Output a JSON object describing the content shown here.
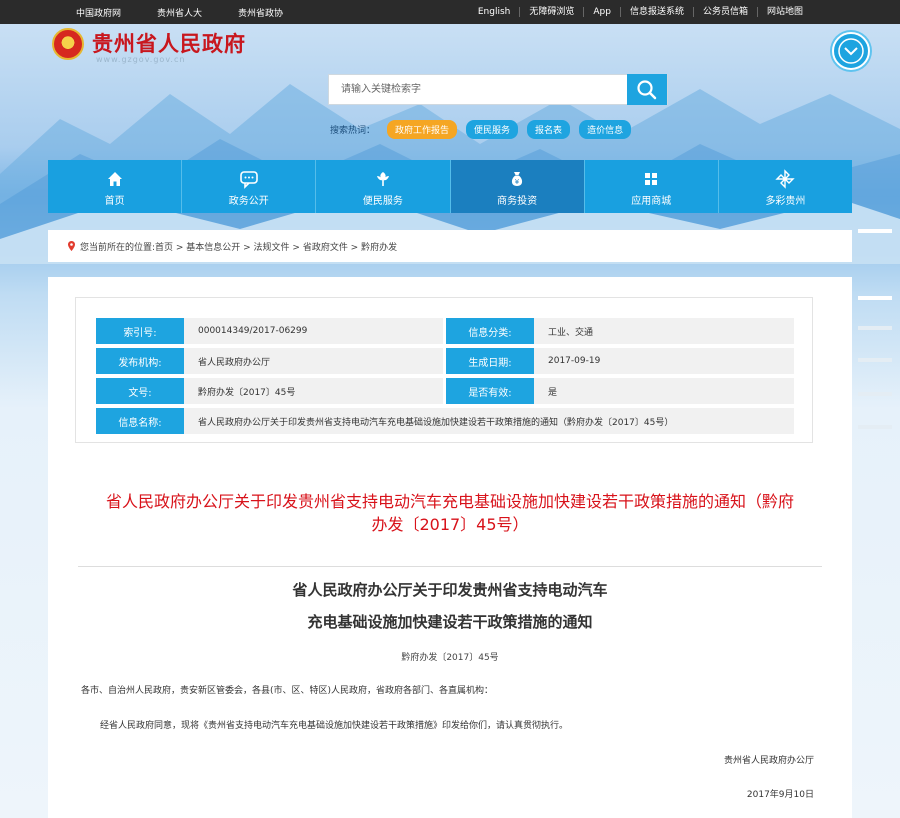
{
  "topbar": {
    "left": [
      "中国政府网",
      "贵州省人大",
      "贵州省政协"
    ],
    "right": [
      "English",
      "无障碍浏览",
      "App",
      "信息报送系统",
      "公务员信箱",
      "网站地图"
    ]
  },
  "header": {
    "site_name": "贵州省人民政府",
    "site_url": "www.gzgov.gov.cn"
  },
  "search": {
    "placeholder": "请输入关键检索字",
    "hot_label": "搜索热词：",
    "hot_tags": [
      "政府工作报告",
      "便民服务",
      "报名表",
      "造价信息"
    ]
  },
  "nav": {
    "items": [
      {
        "label": "首页",
        "icon": "home-icon"
      },
      {
        "label": "政务公开",
        "icon": "chat-icon"
      },
      {
        "label": "便民服务",
        "icon": "flower-icon"
      },
      {
        "label": "商务投资",
        "icon": "money-bag-icon"
      },
      {
        "label": "应用商城",
        "icon": "grid-icon"
      },
      {
        "label": "多彩贵州",
        "icon": "pinwheel-icon"
      }
    ],
    "active_index": 3
  },
  "breadcrumb": {
    "text": "您当前所在的位置:首页 > 基本信息公开 > 法规文件 > 省政府文件 > 黔府办发"
  },
  "info": {
    "index_no_label": "索引号:",
    "index_no": "000014349/2017-06299",
    "category_label": "信息分类:",
    "category": "工业、交通",
    "issuer_label": "发布机构:",
    "issuer": "省人民政府办公厅",
    "date_label": "生成日期:",
    "date": "2017-09-19",
    "docno_label": "文号:",
    "docno": "黔府办发〔2017〕45号",
    "valid_label": "是否有效:",
    "valid": "是",
    "name_label": "信息名称:",
    "name": "省人民政府办公厅关于印发贵州省支持电动汽车充电基础设施加快建设若干政策措施的通知（黔府办发〔2017〕45号）"
  },
  "doc": {
    "title_line1": "省人民政府办公厅关于印发贵州省支持电动汽车充电基础设施加快建设若干政策措施的通知（黔府",
    "title_line2": "办发〔2017〕45号）",
    "heading1": "省人民政府办公厅关于印发贵州省支持电动汽车",
    "heading2": "充电基础设施加快建设若干政策措施的通知",
    "number": "黔府办发〔2017〕45号",
    "recipients": "各市、自治州人民政府，贵安新区管委会，各县(市、区、特区)人民政府，省政府各部门、各直属机构：",
    "body": "经省人民政府同意，现将《贵州省支持电动汽车充电基础设施加快建设若干政策措施》印发给你们，请认真贯彻执行。",
    "signature": "贵州省人民政府办公厅",
    "sign_date": "2017年9月10日"
  },
  "colors": {
    "accent": "#1ea4e0",
    "nav_active": "#1b7fbf",
    "title_red": "#d8121a",
    "hot_first": "#f5a623"
  }
}
